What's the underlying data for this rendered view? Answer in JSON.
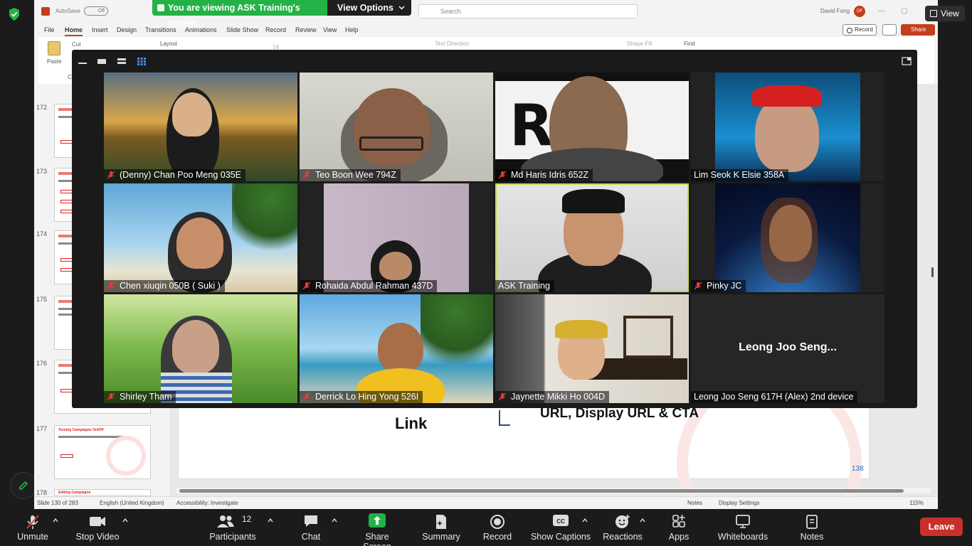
{
  "banner": {
    "viewing_text": "You are viewing ASK Training's screen",
    "view_options": "View Options"
  },
  "view_button": "View",
  "ppt": {
    "autosave": "AutoSave",
    "toggle": "Off",
    "search_placeholder": "Search",
    "user_name": "David Fong",
    "user_initials": "DF",
    "menu": [
      "File",
      "Home",
      "Insert",
      "Design",
      "Transitions",
      "Animations",
      "Slide Show",
      "Record",
      "Review",
      "View",
      "Help"
    ],
    "record_btn": "Record",
    "share_btn": "Share",
    "ribbon": {
      "paste": "Paste",
      "cut": "Cut",
      "layout": "Layout",
      "text_direction": "Text Direction",
      "shape_fill": "Shape Fill",
      "find": "Find",
      "clip": "Clip",
      "font_size": "14"
    },
    "slide_numbers": [
      "172",
      "173",
      "174",
      "175",
      "176",
      "177",
      "178"
    ],
    "thumb_177_caption": "Turning Campaigns On/Off",
    "thumb_178_caption": "Editing Campaigns",
    "slide": {
      "link": "Link",
      "url": "URL, Display URL & CTA",
      "page_number": "138"
    },
    "status": {
      "slide": "Slide 130 of 283",
      "language": "English (United Kingdom)",
      "accessibility": "Accessibility: Investigate",
      "notes": "Notes",
      "display_settings": "Display Settings",
      "zoom": "115%"
    }
  },
  "participants": [
    {
      "name": "(Denny) Chan Poo Meng 035E",
      "muted": true
    },
    {
      "name": "Teo Boon Wee 794Z",
      "muted": true
    },
    {
      "name": "Md Haris Idris 652Z",
      "muted": true
    },
    {
      "name": "Lim Seok K Elsie 358A",
      "muted": false
    },
    {
      "name": "Chen xiuqin 050B ( Suki )",
      "muted": true
    },
    {
      "name": "Rohaida Abdul Rahman 437D",
      "muted": true
    },
    {
      "name": "ASK Training",
      "muted": false,
      "active": true
    },
    {
      "name": "Pinky JC",
      "muted": true
    },
    {
      "name": "Shirley Tham",
      "muted": true
    },
    {
      "name": "Derrick Lo Hing Yong 526I",
      "muted": true
    },
    {
      "name": "Jaynette Mikki Ho 004D",
      "muted": true
    },
    {
      "name": "Leong Joo Seng  617H (Alex) 2nd device",
      "muted": false,
      "video_off_label": "Leong Joo Seng..."
    }
  ],
  "toolbar": {
    "unmute": "Unmute",
    "stop_video": "Stop Video",
    "participants": "Participants",
    "participants_count": "12",
    "chat": "Chat",
    "share_screen": "Share Screen",
    "summary": "Summary",
    "record": "Record",
    "show_captions": "Show Captions",
    "reactions": "Reactions",
    "apps": "Apps",
    "whiteboards": "Whiteboards",
    "notes": "Notes",
    "leave": "Leave"
  },
  "colors": {
    "zoom_green": "#23b246",
    "leave_red": "#c8302c",
    "ppt_accent": "#c43e1c",
    "active_speaker": "#c9d84a"
  }
}
